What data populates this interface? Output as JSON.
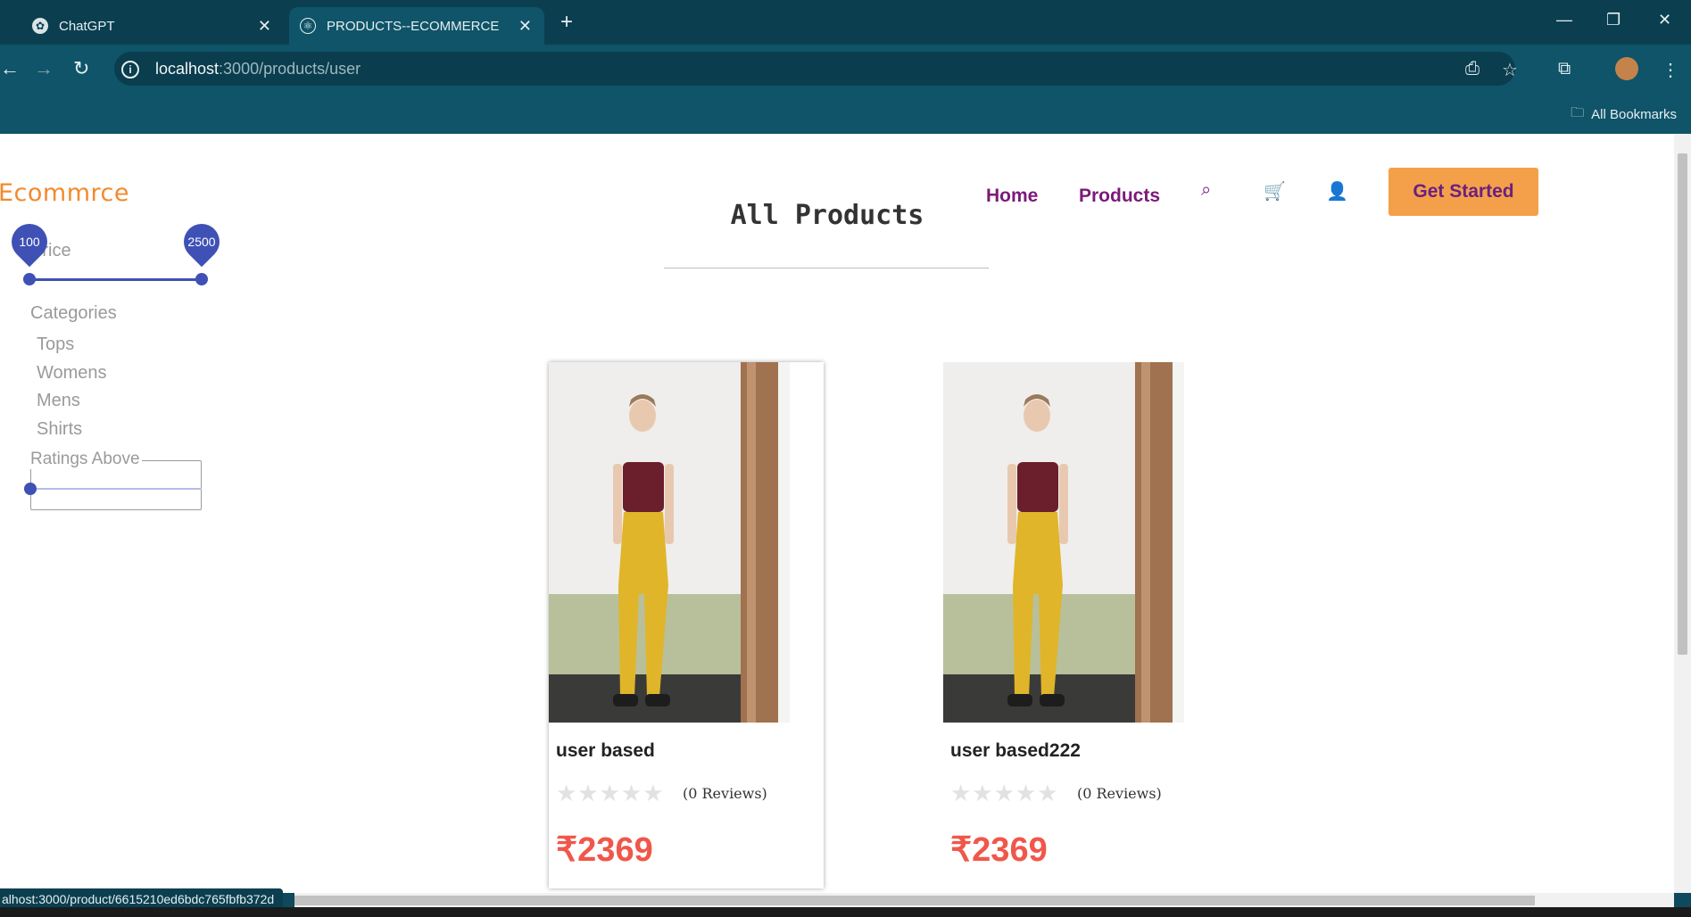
{
  "browser": {
    "tabs": [
      {
        "title": "ChatGPT",
        "icon": "chatgpt-icon"
      },
      {
        "title": "PRODUCTS--ECOMMERCE",
        "icon": "react-icon"
      }
    ],
    "url_host": "localhost",
    "url_path": ":3000/products/user",
    "bookmarks_label": "All Bookmarks",
    "status_url": "alhost:3000/product/6615210ed6bdc765fbfb372d"
  },
  "header": {
    "brand": "Ecommrce",
    "nav": {
      "home": "Home",
      "products": "Products"
    },
    "cta": "Get Started"
  },
  "page": {
    "title": "All Products"
  },
  "filters": {
    "price_label": "Price",
    "price_min": "100",
    "price_max": "2500",
    "categories_title": "Categories",
    "categories": [
      "Tops",
      "Womens",
      "Mens",
      "Shirts"
    ],
    "ratings_label": "Ratings Above",
    "ratings_value": 0
  },
  "products": [
    {
      "name": "user based",
      "rating": 0,
      "reviews": "(0 Reviews)",
      "price": "₹2369"
    },
    {
      "name": "user based222",
      "rating": 0,
      "reviews": "(0 Reviews)",
      "price": "₹2369"
    }
  ],
  "colors": {
    "accent_orange": "#f4a04a",
    "brand_orange": "#f28a2e",
    "nav_purple": "#7a1a7a",
    "slider_blue": "#3f51b5",
    "price_red": "#f0574a"
  }
}
